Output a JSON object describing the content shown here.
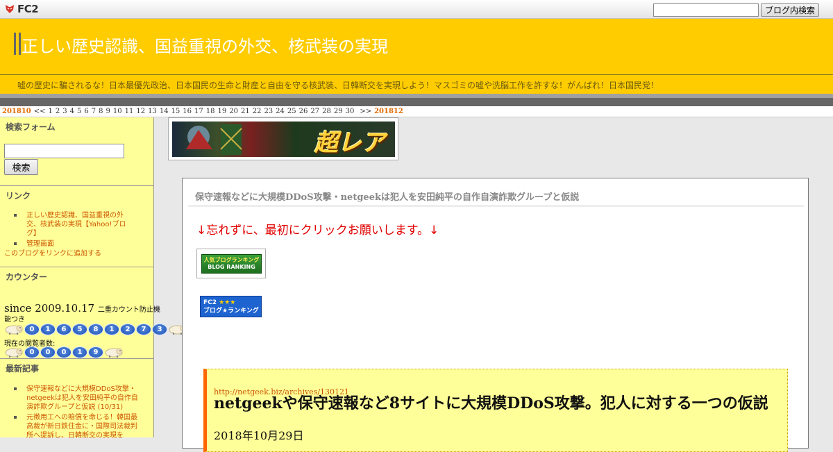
{
  "fc2bar": {
    "logo_text": "FC2",
    "search_placeholder": "",
    "search_button": "ブログ内検索"
  },
  "header": {
    "title": "正しい歴史認識、国益重視の外交、核武装の実現",
    "description": "嘘の歴史に騙されるな！日本最優先政治、日本国民の生命と財産と自由を守る核武装、日韓断交を実現しよう！マスゴミの嘘や洗脳工作を許すな！がんばれ！日本国民党！"
  },
  "calendar": {
    "prev_month": "201810",
    "prev_nav": "<<",
    "next_nav": ">>",
    "next_month": "201812",
    "days": [
      "1",
      "2",
      "3",
      "4",
      "5",
      "6",
      "7",
      "8",
      "9",
      "10",
      "11",
      "12",
      "13",
      "14",
      "15",
      "16",
      "17",
      "18",
      "19",
      "20",
      "21",
      "22",
      "23",
      "24",
      "25",
      "26",
      "27",
      "28",
      "29",
      "30"
    ]
  },
  "sidebar": {
    "search": {
      "title": "検索フォーム",
      "button": "検索"
    },
    "links": {
      "title": "リンク",
      "items": [
        "正しい歴史認識、国益重視の外交、核武装の実現【Yahoo!ブログ】",
        "管理画面"
      ],
      "add_link": "このブログをリンクに追加する"
    },
    "counter": {
      "title": "カウンター",
      "since": "since 2009.10.17",
      "since_note_a": "二重カウント防止機",
      "since_note_b": "能つき",
      "total_digits": [
        "0",
        "1",
        "6",
        "5",
        "8",
        "1",
        "2",
        "7",
        "3"
      ],
      "viewers_label": "現在の閲覧者数:",
      "viewer_digits": [
        "0",
        "0",
        "0",
        "1",
        "9"
      ]
    },
    "recent": {
      "title": "最新記事",
      "items": [
        "保守速報などに大規模DDoS攻撃・netgeekは犯人を安田純平の自作自演詐欺グループと仮説 (10/31)",
        "元徴用工への賠償を命じる！韓国最高裁が新日鉄住金に・国際司法裁判所へ提訴し、日韓断交の実現を"
      ]
    }
  },
  "banner": {
    "text": "超レア"
  },
  "article": {
    "title": "保守速報などに大規模DDoS攻撃・netgeekは犯人を安田純平の自作自演詐欺グループと仮説",
    "click_message": "↓忘れずに、最初にクリックお願いします。↓",
    "rank1_line1": "人気ブログランキング",
    "rank1_line2": "BLOG RANKING",
    "rank2_line1": "FC2",
    "rank2_stars": "★★★",
    "rank2_line2": "ブログ★ランキング",
    "quote": {
      "url": "http://netgeek.biz/archives/130121",
      "title": "netgeekや保守速報など8サイトに大規模DDoS攻撃。犯人に対する一つの仮説",
      "date": "2018年10月29日"
    }
  }
}
